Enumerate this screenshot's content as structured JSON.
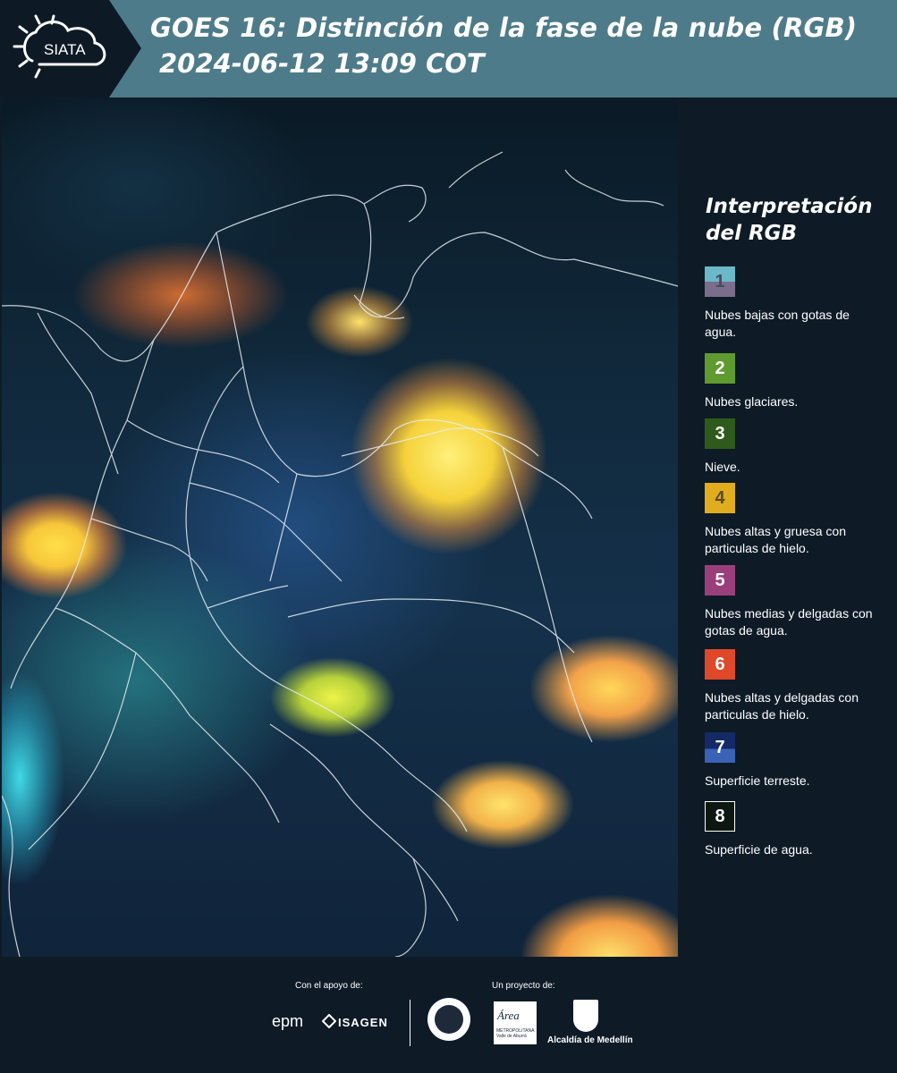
{
  "header": {
    "logo_text": "SIATA",
    "title": "GOES 16: Distinción de la fase de la nube (RGB)",
    "datetime": "2024-06-12 13:09 COT"
  },
  "legend": {
    "title_line1": "Interpretación",
    "title_line2": "del RGB",
    "items": [
      {
        "number": "1",
        "label": "Nubes bajas con gotas de agua.",
        "color_top": "#6ab8c8",
        "color_bottom": "#7a6e8c"
      },
      {
        "number": "2",
        "label": "Nubes glaciares.",
        "color": "#5e9a2e"
      },
      {
        "number": "3",
        "label": "Nieve.",
        "color": "#2e5a1c"
      },
      {
        "number": "4",
        "label": "Nubes altas y gruesa con particulas de hielo.",
        "color": "#e1ad1f"
      },
      {
        "number": "5",
        "label": "Nubes medias y delgadas con gotas de agua.",
        "color": "#9a3f7c"
      },
      {
        "number": "6",
        "label": "Nubes altas y delgadas con particulas de hielo.",
        "color": "#e0482a"
      },
      {
        "number": "7",
        "label": "Superficie terreste.",
        "color_top": "#132a66",
        "color_bottom": "#3a62b6"
      },
      {
        "number": "8",
        "label": "Superficie de agua.",
        "color": "#0b1710"
      }
    ]
  },
  "footer": {
    "support_label": "Con el apoyo de:",
    "project_label": "Un proyecto de:",
    "epm": "epm",
    "isagen": "ISAGEN",
    "area_logo": "Área",
    "area_sub": "METROPOLITANA Valle de Aburrá",
    "alcaldia": "Alcaldía de Medellín"
  }
}
